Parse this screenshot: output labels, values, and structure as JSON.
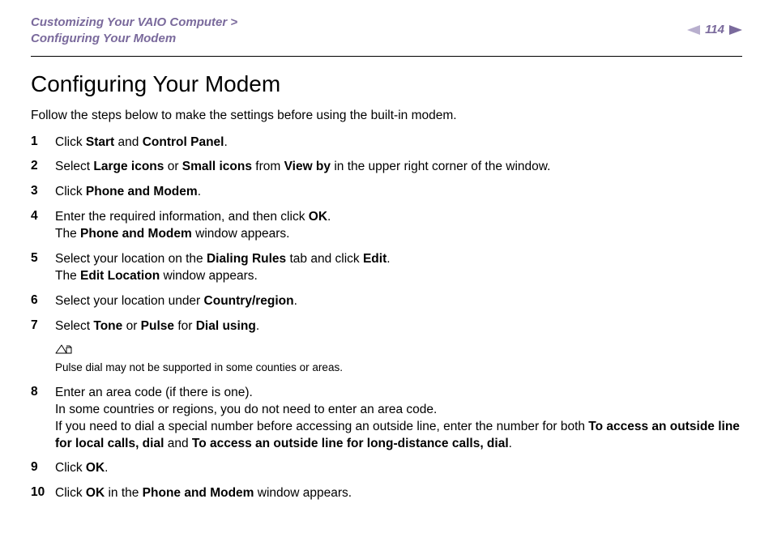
{
  "header": {
    "breadcrumb_line1_a": "Customizing Your VAIO Computer",
    "breadcrumb_line1_sep": " > ",
    "breadcrumb_line2": "Configuring Your Modem",
    "page_number": "114"
  },
  "title": "Configuring Your Modem",
  "intro": "Follow the steps below to make the settings before using the built-in modem.",
  "steps": {
    "s1": {
      "num": "1",
      "p1a": "Click ",
      "b1": "Start",
      "p1b": " and ",
      "b2": "Control Panel",
      "p1c": "."
    },
    "s2": {
      "num": "2",
      "p1a": "Select ",
      "b1": "Large icons",
      "p1b": " or ",
      "b2": "Small icons",
      "p1c": " from ",
      "b3": "View by",
      "p1d": " in the upper right corner of the window."
    },
    "s3": {
      "num": "3",
      "p1a": "Click ",
      "b1": "Phone and Modem",
      "p1b": "."
    },
    "s4": {
      "num": "4",
      "p1a": "Enter the required information, and then click ",
      "b1": "OK",
      "p1b": ".",
      "p2a": "The ",
      "b2": "Phone and Modem",
      "p2b": " window appears."
    },
    "s5": {
      "num": "5",
      "p1a": "Select your location on the ",
      "b1": "Dialing Rules",
      "p1b": " tab and click ",
      "b2": "Edit",
      "p1c": ".",
      "p2a": "The ",
      "b3": "Edit Location",
      "p2b": " window appears."
    },
    "s6": {
      "num": "6",
      "p1a": "Select your location under ",
      "b1": "Country/region",
      "p1b": "."
    },
    "s7": {
      "num": "7",
      "p1a": "Select ",
      "b1": "Tone",
      "p1b": " or ",
      "b2": "Pulse",
      "p1c": " for ",
      "b3": "Dial using",
      "p1d": "."
    },
    "s8": {
      "num": "8",
      "p1a": "Enter an area code (if there is one).",
      "p2a": "In some countries or regions, you do not need to enter an area code.",
      "p3a": "If you need to dial a special number before accessing an outside line, enter the number for both ",
      "b1": "To access an outside line for local calls, dial",
      "p3b": " and ",
      "b2": "To access an outside line for long-distance calls, dial",
      "p3c": "."
    },
    "s9": {
      "num": "9",
      "p1a": "Click ",
      "b1": "OK",
      "p1b": "."
    },
    "s10": {
      "num": "10",
      "p1a": "Click ",
      "b1": "OK",
      "p1b": " in the ",
      "b2": "Phone and Modem",
      "p1c": " window appears."
    }
  },
  "note": {
    "text": "Pulse dial may not be supported in some counties or areas."
  }
}
